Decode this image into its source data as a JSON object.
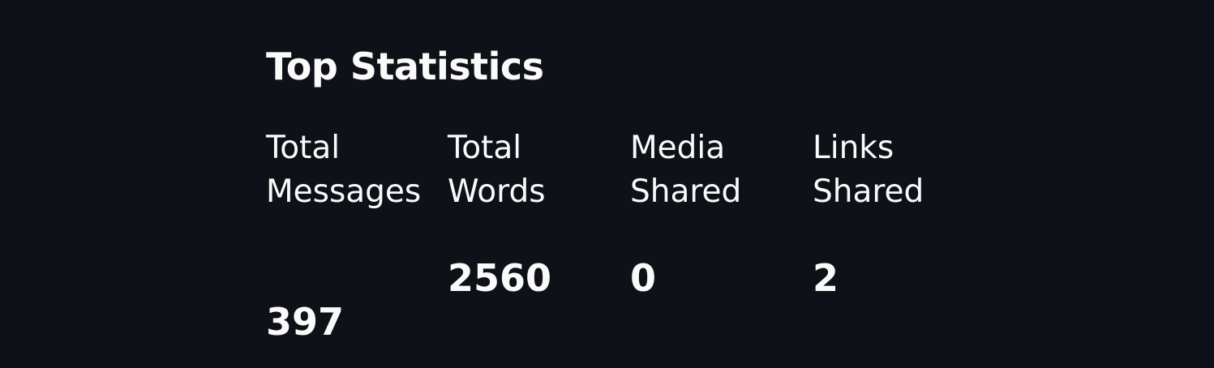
{
  "page": {
    "title": "Top Statistics"
  },
  "stats": [
    {
      "label": "Total Messages",
      "value": "397"
    },
    {
      "label": "Total Words",
      "value": "2560"
    },
    {
      "label": "Media Shared",
      "value": "0"
    },
    {
      "label": "Links Shared",
      "value": "2"
    }
  ],
  "colors": {
    "background": "#0e1117",
    "text": "#fafafa"
  }
}
